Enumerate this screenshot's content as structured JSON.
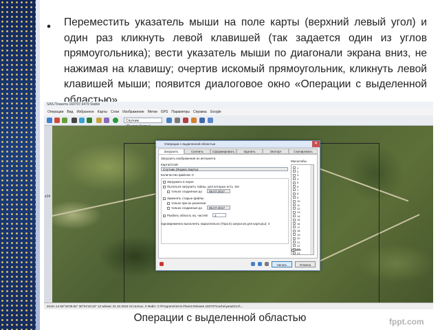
{
  "slide": {
    "bullet": "•",
    "text": "Переместить указатель мыши на поле карты (верхний левый угол) и один раз кликнуть левой клавишей (так задается один из углов прямоугольника); вести указатель мыши по диагонали экрана вниз, не нажимая на клавишу; очертив искомый прямоугольник, кликнуть левой клавишей мыши; появится диалоговое окно «Операции с выделенной областью».",
    "caption": "Операции с выделенной областью",
    "watermark": "fppt.com"
  },
  "app": {
    "title": "SAS.Планета 160707.9479 Stable",
    "menu": [
      "Операции",
      "Вид",
      "Избранное",
      "Карты",
      "Слои",
      "Изображение",
      "Метки",
      "GPS",
      "Параметры",
      "Справка",
      "Google"
    ],
    "map_source": "Спутник (Яндекс.Карты)",
    "status": "Zoom 14   56°34'09.82\" 38°04'18.32\"   12 м/пикс   31.10.2016   Осталось: 0   Файл: C:\\Programs\\SAS.Planet.Release.160707\\cache\\yasat\\z14\\..."
  },
  "dialog": {
    "title": "Операции с выделенной областью",
    "close": "✕",
    "tabs": [
      "Загрузить",
      "Склеить",
      "Сформировать",
      "Удалить",
      "Экспорт",
      "Скопировать"
    ],
    "load_label": "Загрузить изображения из интернета",
    "map_label": "Карта/Слой",
    "map_value": "Спутник (Яндекс.Карты)",
    "tiles_label": "Количество файлов: 0",
    "pause_label": "Загружать в паузе",
    "retry_label": "Пытаться загрузить тайлы, для которых есть .tne",
    "only_created_label": "только созданные до",
    "date1": "05.07.2017",
    "replace_label": "Заменять старые файлы",
    "if_different_label": "только при их различии",
    "date2": "05.07.2017",
    "split_label": "Разбить область на, частей",
    "split_value": "2",
    "threads_label": "Одновременно выполнять параллельно (TopLS) запросов для карты(ы): 4",
    "zooms_label": "Масштабы",
    "zooms": [
      "1",
      "2",
      "3",
      "4",
      "5",
      "6",
      "7",
      "8",
      "9",
      "10",
      "11",
      "12",
      "13",
      "14",
      "15",
      "16",
      "17",
      "18",
      "19",
      "20",
      "21",
      "22",
      "23",
      "24"
    ],
    "all_label": "Все",
    "start_button": "Начать",
    "cancel_button": "Отмена"
  }
}
